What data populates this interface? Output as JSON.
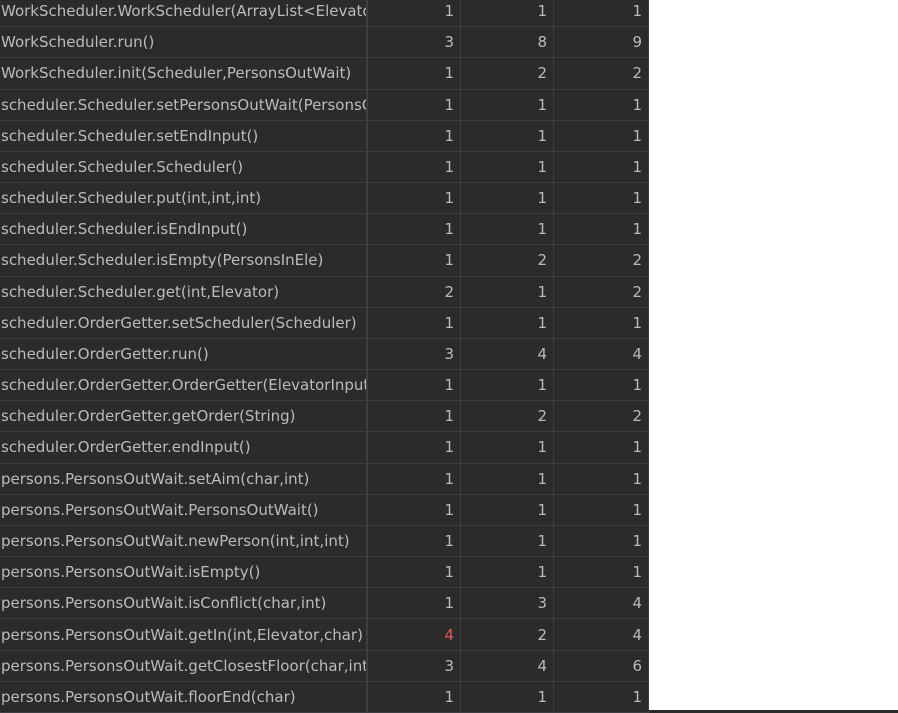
{
  "colors": {
    "background": "#2b2b2b",
    "text": "#bbbbbb",
    "grid": "#3c3f41",
    "highlight": "#e05a5a",
    "blank_area": "#ffffff"
  },
  "rows": [
    {
      "method": "WorkScheduler.WorkScheduler(ArrayList<Elevator",
      "a": "1",
      "b": "1",
      "c": "1"
    },
    {
      "method": "WorkScheduler.run()",
      "a": "3",
      "b": "8",
      "c": "9"
    },
    {
      "method": "WorkScheduler.init(Scheduler,PersonsOutWait)",
      "a": "1",
      "b": "2",
      "c": "2"
    },
    {
      "method": "scheduler.Scheduler.setPersonsOutWait(PersonsO",
      "a": "1",
      "b": "1",
      "c": "1"
    },
    {
      "method": "scheduler.Scheduler.setEndInput()",
      "a": "1",
      "b": "1",
      "c": "1"
    },
    {
      "method": "scheduler.Scheduler.Scheduler()",
      "a": "1",
      "b": "1",
      "c": "1"
    },
    {
      "method": "scheduler.Scheduler.put(int,int,int)",
      "a": "1",
      "b": "1",
      "c": "1"
    },
    {
      "method": "scheduler.Scheduler.isEndInput()",
      "a": "1",
      "b": "1",
      "c": "1"
    },
    {
      "method": "scheduler.Scheduler.isEmpty(PersonsInEle)",
      "a": "1",
      "b": "2",
      "c": "2"
    },
    {
      "method": "scheduler.Scheduler.get(int,Elevator)",
      "a": "2",
      "b": "1",
      "c": "2"
    },
    {
      "method": "scheduler.OrderGetter.setScheduler(Scheduler)",
      "a": "1",
      "b": "1",
      "c": "1"
    },
    {
      "method": "scheduler.OrderGetter.run()",
      "a": "3",
      "b": "4",
      "c": "4"
    },
    {
      "method": "scheduler.OrderGetter.OrderGetter(ElevatorInput)",
      "a": "1",
      "b": "1",
      "c": "1"
    },
    {
      "method": "scheduler.OrderGetter.getOrder(String)",
      "a": "1",
      "b": "2",
      "c": "2"
    },
    {
      "method": "scheduler.OrderGetter.endInput()",
      "a": "1",
      "b": "1",
      "c": "1"
    },
    {
      "method": "persons.PersonsOutWait.setAim(char,int)",
      "a": "1",
      "b": "1",
      "c": "1"
    },
    {
      "method": "persons.PersonsOutWait.PersonsOutWait()",
      "a": "1",
      "b": "1",
      "c": "1"
    },
    {
      "method": "persons.PersonsOutWait.newPerson(int,int,int)",
      "a": "1",
      "b": "1",
      "c": "1"
    },
    {
      "method": "persons.PersonsOutWait.isEmpty()",
      "a": "1",
      "b": "1",
      "c": "1"
    },
    {
      "method": "persons.PersonsOutWait.isConflict(char,int)",
      "a": "1",
      "b": "3",
      "c": "4"
    },
    {
      "method": "persons.PersonsOutWait.getIn(int,Elevator,char)",
      "a": "4",
      "b": "2",
      "c": "4",
      "highlight_a": true
    },
    {
      "method": "persons.PersonsOutWait.getClosestFloor(char,int)",
      "a": "3",
      "b": "4",
      "c": "6"
    },
    {
      "method": "persons.PersonsOutWait.floorEnd(char)",
      "a": "1",
      "b": "1",
      "c": "1"
    }
  ]
}
